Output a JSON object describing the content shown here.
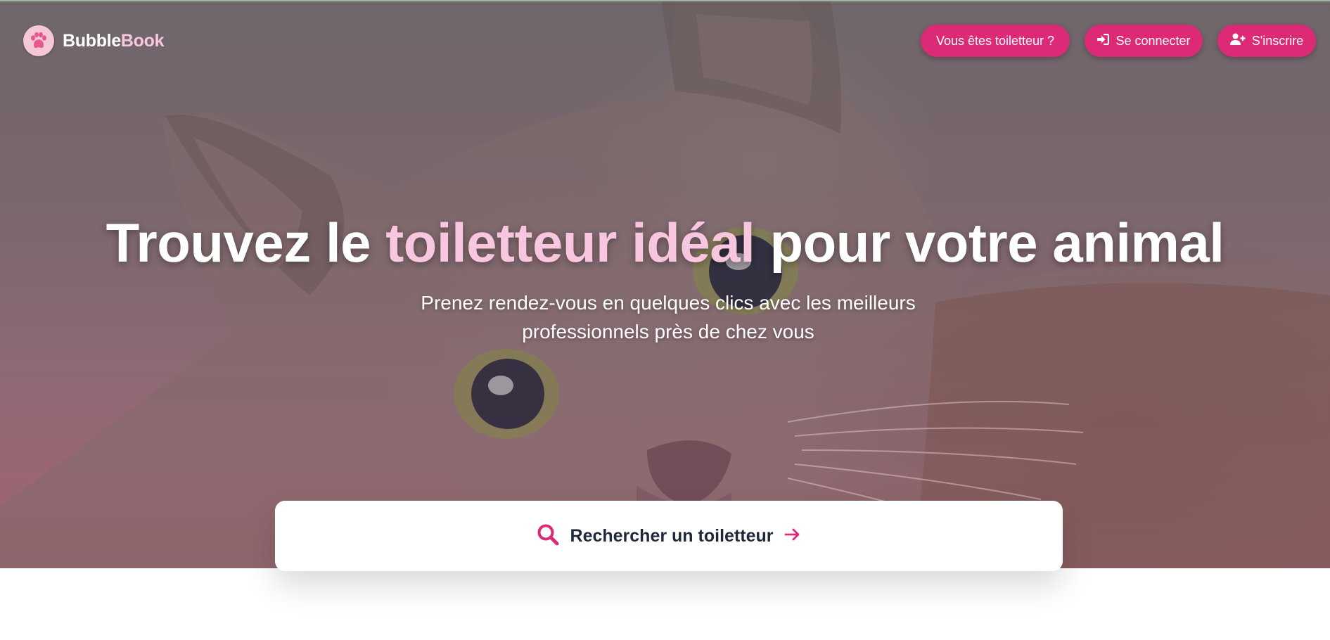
{
  "brand": {
    "name_part1": "Bubble",
    "name_part2": "Book",
    "logo_icon": "paw-icon"
  },
  "nav": {
    "groomer_label": "Vous êtes toiletteur ?",
    "login_label": "Se connecter",
    "login_icon": "sign-in-icon",
    "signup_label": "S'inscrire",
    "signup_icon": "user-plus-icon"
  },
  "hero": {
    "title_before": "Trouvez le ",
    "title_highlight": "toiletteur idéal",
    "title_after": " pour votre animal",
    "subtitle_line1": "Prenez rendez-vous en quelques clics avec les meilleurs",
    "subtitle_line2": "professionnels près de chez vous",
    "background": "cat-photo"
  },
  "search": {
    "label": "Rechercher un toiletteur",
    "icon": "search-icon",
    "arrow_icon": "arrow-right-icon"
  },
  "colors": {
    "accent": "#dc2a76",
    "highlight": "#f9c6df",
    "text_dark": "#1e2a3b",
    "logo_badge": "#f6c7d6"
  }
}
